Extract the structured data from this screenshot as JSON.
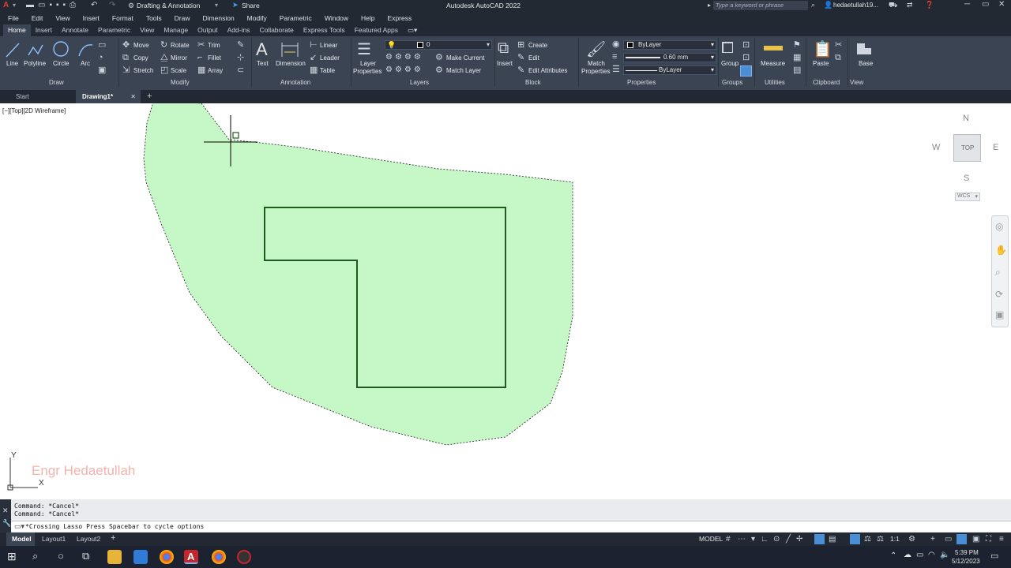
{
  "title_bar": {
    "workspace": "Drafting & Annotation",
    "share": "Share",
    "app_title": "Autodesk AutoCAD 2022",
    "search_placeholder": "Type a keyword or phrase",
    "user": "hedaetullah19..."
  },
  "menu": [
    "File",
    "Edit",
    "View",
    "Insert",
    "Format",
    "Tools",
    "Draw",
    "Dimension",
    "Modify",
    "Parametric",
    "Window",
    "Help",
    "Express"
  ],
  "ribbon_tabs": [
    "Home",
    "Insert",
    "Annotate",
    "Parametric",
    "View",
    "Manage",
    "Output",
    "Add-ins",
    "Collaborate",
    "Express Tools",
    "Featured Apps"
  ],
  "ribbon": {
    "draw": {
      "title": "Draw",
      "line": "Line",
      "polyline": "Polyline",
      "circle": "Circle",
      "arc": "Arc"
    },
    "modify": {
      "title": "Modify",
      "move": "Move",
      "rotate": "Rotate",
      "trim": "Trim",
      "copy": "Copy",
      "mirror": "Mirror",
      "fillet": "Fillet",
      "stretch": "Stretch",
      "scale": "Scale",
      "array": "Array"
    },
    "annotation": {
      "title": "Annotation",
      "text": "Text",
      "dimension": "Dimension",
      "linear": "Linear",
      "leader": "Leader",
      "table": "Table"
    },
    "layers": {
      "title": "Layers",
      "layer_properties_1": "Layer",
      "layer_properties_2": "Properties",
      "current_layer": "0",
      "make_current": "Make Current",
      "match_layer": "Match Layer"
    },
    "block": {
      "title": "Block",
      "insert": "Insert",
      "create": "Create",
      "edit": "Edit",
      "edit_attributes": "Edit Attributes"
    },
    "properties": {
      "title": "Properties",
      "match_1": "Match",
      "match_2": "Properties",
      "color": "ByLayer",
      "lineweight": "0.60 mm",
      "linetype": "ByLayer"
    },
    "groups": {
      "title": "Groups",
      "group": "Group"
    },
    "utilities": {
      "title": "Utilities",
      "measure": "Measure"
    },
    "clipboard": {
      "title": "Clipboard",
      "paste": "Paste"
    },
    "view": {
      "title": "View",
      "base": "Base"
    }
  },
  "doc_tabs": {
    "start": "Start",
    "drawing": "Drawing1*"
  },
  "viewport": {
    "label": "[−][Top][2D Wireframe]",
    "compass": {
      "n": "N",
      "s": "S",
      "e": "E",
      "w": "W",
      "top": "TOP",
      "wcs": "WCS"
    },
    "watermark": "Engr Hedaetullah",
    "ucs_x": "X",
    "ucs_y": "Y"
  },
  "command": {
    "history": [
      "Command: *Cancel*",
      "Command: *Cancel*"
    ],
    "prompt": "*Crossing Lasso  Press Spacebar to cycle options"
  },
  "layout_tabs": [
    "Model",
    "Layout1",
    "Layout2"
  ],
  "status": {
    "model": "MODEL",
    "scale": "1:1"
  },
  "clock": {
    "time": "5:39 PM",
    "date": "5/12/2023"
  },
  "colors": {
    "lasso_fill": "#c6f7c6",
    "shape_stroke": "#1e5a1e",
    "ribbon_bg": "#3b4453",
    "dark_bg": "#222933"
  }
}
